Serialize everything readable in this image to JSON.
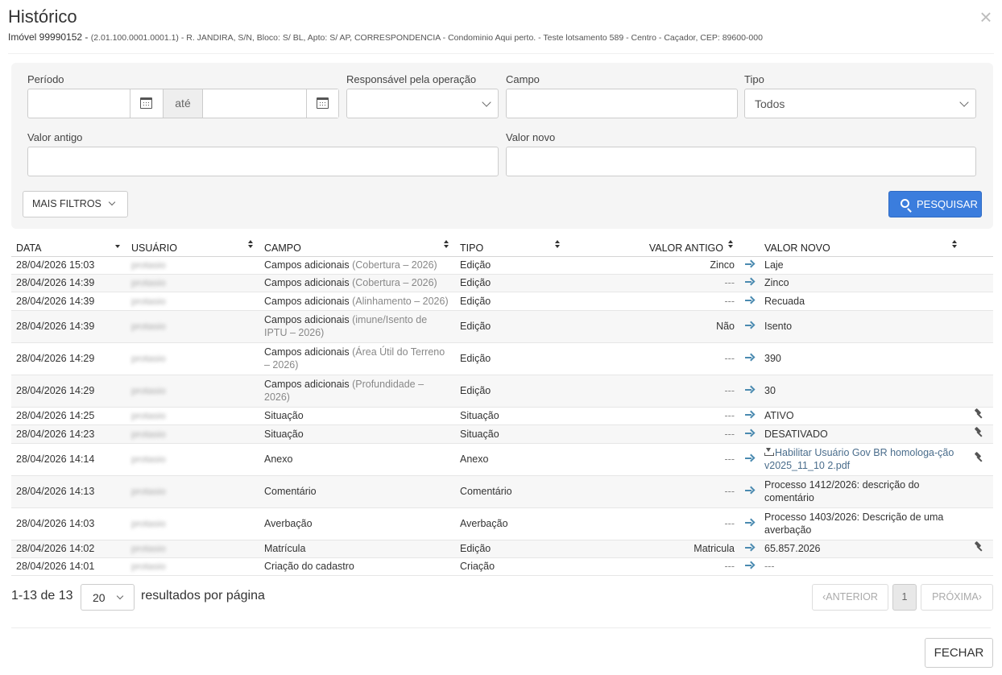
{
  "title": "Histórico",
  "subtitle": {
    "imovel": "Imóvel 99990152 - ",
    "address": "(2.01.100.0001.0001.1) - R. JANDIRA, S/N, Bloco: S/ BL, Apto: S/ AP, CORRESPONDENCIA - Condominio Aqui perto. - Teste lotsamento 589 - Centro - Caçador, CEP: 89600-000"
  },
  "filters": {
    "periodo_label": "Período",
    "periodo_from": "",
    "ate_label": "até",
    "periodo_to": "",
    "responsavel_label": "Responsável pela operação",
    "responsavel_value": "",
    "campo_label": "Campo",
    "campo_value": "",
    "tipo_label": "Tipo",
    "tipo_value": "Todos",
    "valor_antigo_label": "Valor antigo",
    "valor_antigo_value": "",
    "valor_novo_label": "Valor novo",
    "valor_novo_value": "",
    "mais_filtros_label": "MAIS FILTROS",
    "pesquisar_label": "PESQUISAR"
  },
  "table": {
    "headers": [
      "DATA",
      "USUÁRIO",
      "CAMPO",
      "TIPO",
      "VALOR ANTIGO",
      "VALOR NOVO"
    ],
    "rows": [
      {
        "data": "28/04/2026 15:03",
        "usuario": "protasio",
        "campo": "Campos adicionais",
        "campo_sub": "(Cobertura – 2026)",
        "tipo": "Edição",
        "antigo": "Zinco",
        "novo": "Laje",
        "revert": false
      },
      {
        "data": "28/04/2026 14:39",
        "usuario": "protasio",
        "campo": "Campos adicionais",
        "campo_sub": "(Cobertura – 2026)",
        "tipo": "Edição",
        "antigo": "---",
        "novo": "Zinco",
        "revert": false
      },
      {
        "data": "28/04/2026 14:39",
        "usuario": "protasio",
        "campo": "Campos adicionais",
        "campo_sub": "(Alinhamento – 2026)",
        "tipo": "Edição",
        "antigo": "---",
        "novo": "Recuada",
        "revert": false
      },
      {
        "data": "28/04/2026 14:39",
        "usuario": "protasio",
        "campo": "Campos adicionais",
        "campo_sub": "(imune/Isento de IPTU – 2026)",
        "tipo": "Edição",
        "antigo": "Não",
        "novo": "Isento",
        "revert": false
      },
      {
        "data": "28/04/2026 14:29",
        "usuario": "protasio",
        "campo": "Campos adicionais",
        "campo_sub": "(Área Útil do Terreno – 2026)",
        "tipo": "Edição",
        "antigo": "---",
        "novo": "390",
        "revert": false
      },
      {
        "data": "28/04/2026 14:29",
        "usuario": "protasio",
        "campo": "Campos adicionais",
        "campo_sub": "(Profundidade – 2026)",
        "tipo": "Edição",
        "antigo": "---",
        "novo": "30",
        "revert": false
      },
      {
        "data": "28/04/2026 14:25",
        "usuario": "protasio",
        "campo": "Situação",
        "campo_sub": "",
        "tipo": "Situação",
        "antigo": "---",
        "novo": "ATIVO",
        "revert": true
      },
      {
        "data": "28/04/2026 14:23",
        "usuario": "protasio",
        "campo": "Situação",
        "campo_sub": "",
        "tipo": "Situação",
        "antigo": "---",
        "novo": "DESATIVADO",
        "revert": true
      },
      {
        "data": "28/04/2026 14:14",
        "usuario": "protasio",
        "campo": "Anexo",
        "campo_sub": "",
        "tipo": "Anexo",
        "antigo": "---",
        "novo": "Habilitar Usuário Gov BR homologa-ção v2025_11_10 2.pdf",
        "revert": true
      },
      {
        "data": "28/04/2026 14:13",
        "usuario": "protasio",
        "campo": "Comentário",
        "campo_sub": "",
        "tipo": "Comentário",
        "antigo": "---",
        "novo": "Processo 1412/2026: descrição do comentário",
        "revert": false
      },
      {
        "data": "28/04/2026 14:03",
        "usuario": "protasio",
        "campo": "Averbação",
        "campo_sub": "",
        "tipo": "Averbação",
        "antigo": "---",
        "novo": "Processo 1403/2026: Descrição de uma averbação",
        "revert": false
      },
      {
        "data": "28/04/2026 14:02",
        "usuario": "protasio",
        "campo": "Matrícula",
        "campo_sub": "",
        "tipo": "Edição",
        "antigo": "Matricula",
        "novo": "65.857.2026",
        "revert": true
      },
      {
        "data": "28/04/2026 14:01",
        "usuario": "protasio",
        "campo": "Criação do cadastro",
        "campo_sub": "",
        "tipo": "Criação",
        "antigo": "---",
        "novo": "---",
        "revert": false
      }
    ]
  },
  "pagination": {
    "summary": "1-13 de 13",
    "per_page": "20",
    "per_page_label": "resultados por página",
    "prev_label": "ANTERIOR",
    "current_page": "1",
    "next_label": "PRÓXIMA"
  },
  "footer": {
    "close_label": "FECHAR"
  }
}
